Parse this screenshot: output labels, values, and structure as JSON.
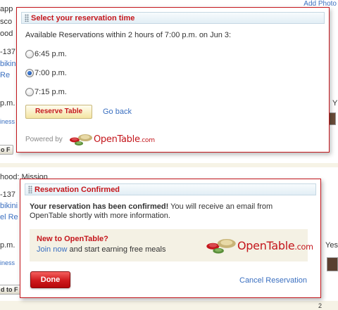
{
  "background": {
    "add_photo": "Add Photo",
    "frag_addr1": "app",
    "frag_sco": "sco",
    "frag_ood": "ood",
    "frag_137a": "-137",
    "frag_bikini_a": "bikini",
    "frag_re": "Re",
    "frag_pm_a": "p.m.",
    "frag_iness_a": "iness",
    "frag_y": "Y",
    "frag_tof_a": "o F",
    "frag_hood": "hood: Mission",
    "frag_137b": "-137",
    "frag_bikini_b": "bikini",
    "frag_el_re": "el Re",
    "frag_pm_b": "p.m.",
    "frag_yes": "Yes",
    "frag_iness_b": "iness",
    "frag_tof_b": "d to F",
    "frag_bottom_num": "2"
  },
  "popup1": {
    "title": "Select your reservation time",
    "available_text": "Available Reservations within 2 hours of 7:00 p.m. on Jun 3:",
    "options": [
      {
        "label": "6:45 p.m.",
        "checked": false
      },
      {
        "label": "7:00 p.m.",
        "checked": true
      },
      {
        "label": "7:15 p.m.",
        "checked": false
      }
    ],
    "reserve_button": "Reserve Table",
    "go_back_link": "Go back",
    "powered_by": "Powered by",
    "logo_text": "OpenTable",
    "logo_domain": ".com"
  },
  "popup2": {
    "title": "Reservation Confirmed",
    "confirm_bold": "Your reservation has been confirmed!",
    "confirm_rest": " You will receive an email from OpenTable shortly with more information.",
    "new_title": "New to OpenTable?",
    "join_link": "Join now",
    "join_rest": " and start earning free meals",
    "logo_text": "OpenTable",
    "logo_domain": ".com",
    "done_button": "Done",
    "cancel_link": "Cancel Reservation"
  },
  "colors": {
    "accent_red": "#c4161c",
    "link_blue": "#3a6fc0",
    "header_blue": "#e2eef5"
  }
}
